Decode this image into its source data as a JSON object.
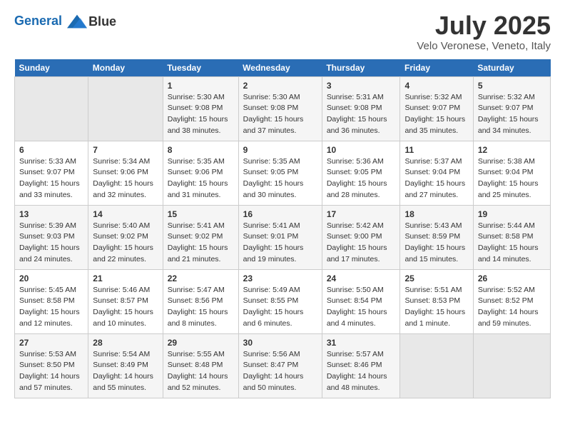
{
  "header": {
    "logo_line1": "General",
    "logo_line2": "Blue",
    "title": "July 2025",
    "subtitle": "Velo Veronese, Veneto, Italy"
  },
  "weekdays": [
    "Sunday",
    "Monday",
    "Tuesday",
    "Wednesday",
    "Thursday",
    "Friday",
    "Saturday"
  ],
  "weeks": [
    [
      {
        "day": "",
        "sunrise": "",
        "sunset": "",
        "daylight": ""
      },
      {
        "day": "",
        "sunrise": "",
        "sunset": "",
        "daylight": ""
      },
      {
        "day": "1",
        "sunrise": "Sunrise: 5:30 AM",
        "sunset": "Sunset: 9:08 PM",
        "daylight": "Daylight: 15 hours and 38 minutes."
      },
      {
        "day": "2",
        "sunrise": "Sunrise: 5:30 AM",
        "sunset": "Sunset: 9:08 PM",
        "daylight": "Daylight: 15 hours and 37 minutes."
      },
      {
        "day": "3",
        "sunrise": "Sunrise: 5:31 AM",
        "sunset": "Sunset: 9:08 PM",
        "daylight": "Daylight: 15 hours and 36 minutes."
      },
      {
        "day": "4",
        "sunrise": "Sunrise: 5:32 AM",
        "sunset": "Sunset: 9:07 PM",
        "daylight": "Daylight: 15 hours and 35 minutes."
      },
      {
        "day": "5",
        "sunrise": "Sunrise: 5:32 AM",
        "sunset": "Sunset: 9:07 PM",
        "daylight": "Daylight: 15 hours and 34 minutes."
      }
    ],
    [
      {
        "day": "6",
        "sunrise": "Sunrise: 5:33 AM",
        "sunset": "Sunset: 9:07 PM",
        "daylight": "Daylight: 15 hours and 33 minutes."
      },
      {
        "day": "7",
        "sunrise": "Sunrise: 5:34 AM",
        "sunset": "Sunset: 9:06 PM",
        "daylight": "Daylight: 15 hours and 32 minutes."
      },
      {
        "day": "8",
        "sunrise": "Sunrise: 5:35 AM",
        "sunset": "Sunset: 9:06 PM",
        "daylight": "Daylight: 15 hours and 31 minutes."
      },
      {
        "day": "9",
        "sunrise": "Sunrise: 5:35 AM",
        "sunset": "Sunset: 9:05 PM",
        "daylight": "Daylight: 15 hours and 30 minutes."
      },
      {
        "day": "10",
        "sunrise": "Sunrise: 5:36 AM",
        "sunset": "Sunset: 9:05 PM",
        "daylight": "Daylight: 15 hours and 28 minutes."
      },
      {
        "day": "11",
        "sunrise": "Sunrise: 5:37 AM",
        "sunset": "Sunset: 9:04 PM",
        "daylight": "Daylight: 15 hours and 27 minutes."
      },
      {
        "day": "12",
        "sunrise": "Sunrise: 5:38 AM",
        "sunset": "Sunset: 9:04 PM",
        "daylight": "Daylight: 15 hours and 25 minutes."
      }
    ],
    [
      {
        "day": "13",
        "sunrise": "Sunrise: 5:39 AM",
        "sunset": "Sunset: 9:03 PM",
        "daylight": "Daylight: 15 hours and 24 minutes."
      },
      {
        "day": "14",
        "sunrise": "Sunrise: 5:40 AM",
        "sunset": "Sunset: 9:02 PM",
        "daylight": "Daylight: 15 hours and 22 minutes."
      },
      {
        "day": "15",
        "sunrise": "Sunrise: 5:41 AM",
        "sunset": "Sunset: 9:02 PM",
        "daylight": "Daylight: 15 hours and 21 minutes."
      },
      {
        "day": "16",
        "sunrise": "Sunrise: 5:41 AM",
        "sunset": "Sunset: 9:01 PM",
        "daylight": "Daylight: 15 hours and 19 minutes."
      },
      {
        "day": "17",
        "sunrise": "Sunrise: 5:42 AM",
        "sunset": "Sunset: 9:00 PM",
        "daylight": "Daylight: 15 hours and 17 minutes."
      },
      {
        "day": "18",
        "sunrise": "Sunrise: 5:43 AM",
        "sunset": "Sunset: 8:59 PM",
        "daylight": "Daylight: 15 hours and 15 minutes."
      },
      {
        "day": "19",
        "sunrise": "Sunrise: 5:44 AM",
        "sunset": "Sunset: 8:58 PM",
        "daylight": "Daylight: 15 hours and 14 minutes."
      }
    ],
    [
      {
        "day": "20",
        "sunrise": "Sunrise: 5:45 AM",
        "sunset": "Sunset: 8:58 PM",
        "daylight": "Daylight: 15 hours and 12 minutes."
      },
      {
        "day": "21",
        "sunrise": "Sunrise: 5:46 AM",
        "sunset": "Sunset: 8:57 PM",
        "daylight": "Daylight: 15 hours and 10 minutes."
      },
      {
        "day": "22",
        "sunrise": "Sunrise: 5:47 AM",
        "sunset": "Sunset: 8:56 PM",
        "daylight": "Daylight: 15 hours and 8 minutes."
      },
      {
        "day": "23",
        "sunrise": "Sunrise: 5:49 AM",
        "sunset": "Sunset: 8:55 PM",
        "daylight": "Daylight: 15 hours and 6 minutes."
      },
      {
        "day": "24",
        "sunrise": "Sunrise: 5:50 AM",
        "sunset": "Sunset: 8:54 PM",
        "daylight": "Daylight: 15 hours and 4 minutes."
      },
      {
        "day": "25",
        "sunrise": "Sunrise: 5:51 AM",
        "sunset": "Sunset: 8:53 PM",
        "daylight": "Daylight: 15 hours and 1 minute."
      },
      {
        "day": "26",
        "sunrise": "Sunrise: 5:52 AM",
        "sunset": "Sunset: 8:52 PM",
        "daylight": "Daylight: 14 hours and 59 minutes."
      }
    ],
    [
      {
        "day": "27",
        "sunrise": "Sunrise: 5:53 AM",
        "sunset": "Sunset: 8:50 PM",
        "daylight": "Daylight: 14 hours and 57 minutes."
      },
      {
        "day": "28",
        "sunrise": "Sunrise: 5:54 AM",
        "sunset": "Sunset: 8:49 PM",
        "daylight": "Daylight: 14 hours and 55 minutes."
      },
      {
        "day": "29",
        "sunrise": "Sunrise: 5:55 AM",
        "sunset": "Sunset: 8:48 PM",
        "daylight": "Daylight: 14 hours and 52 minutes."
      },
      {
        "day": "30",
        "sunrise": "Sunrise: 5:56 AM",
        "sunset": "Sunset: 8:47 PM",
        "daylight": "Daylight: 14 hours and 50 minutes."
      },
      {
        "day": "31",
        "sunrise": "Sunrise: 5:57 AM",
        "sunset": "Sunset: 8:46 PM",
        "daylight": "Daylight: 14 hours and 48 minutes."
      },
      {
        "day": "",
        "sunrise": "",
        "sunset": "",
        "daylight": ""
      },
      {
        "day": "",
        "sunrise": "",
        "sunset": "",
        "daylight": ""
      }
    ]
  ]
}
